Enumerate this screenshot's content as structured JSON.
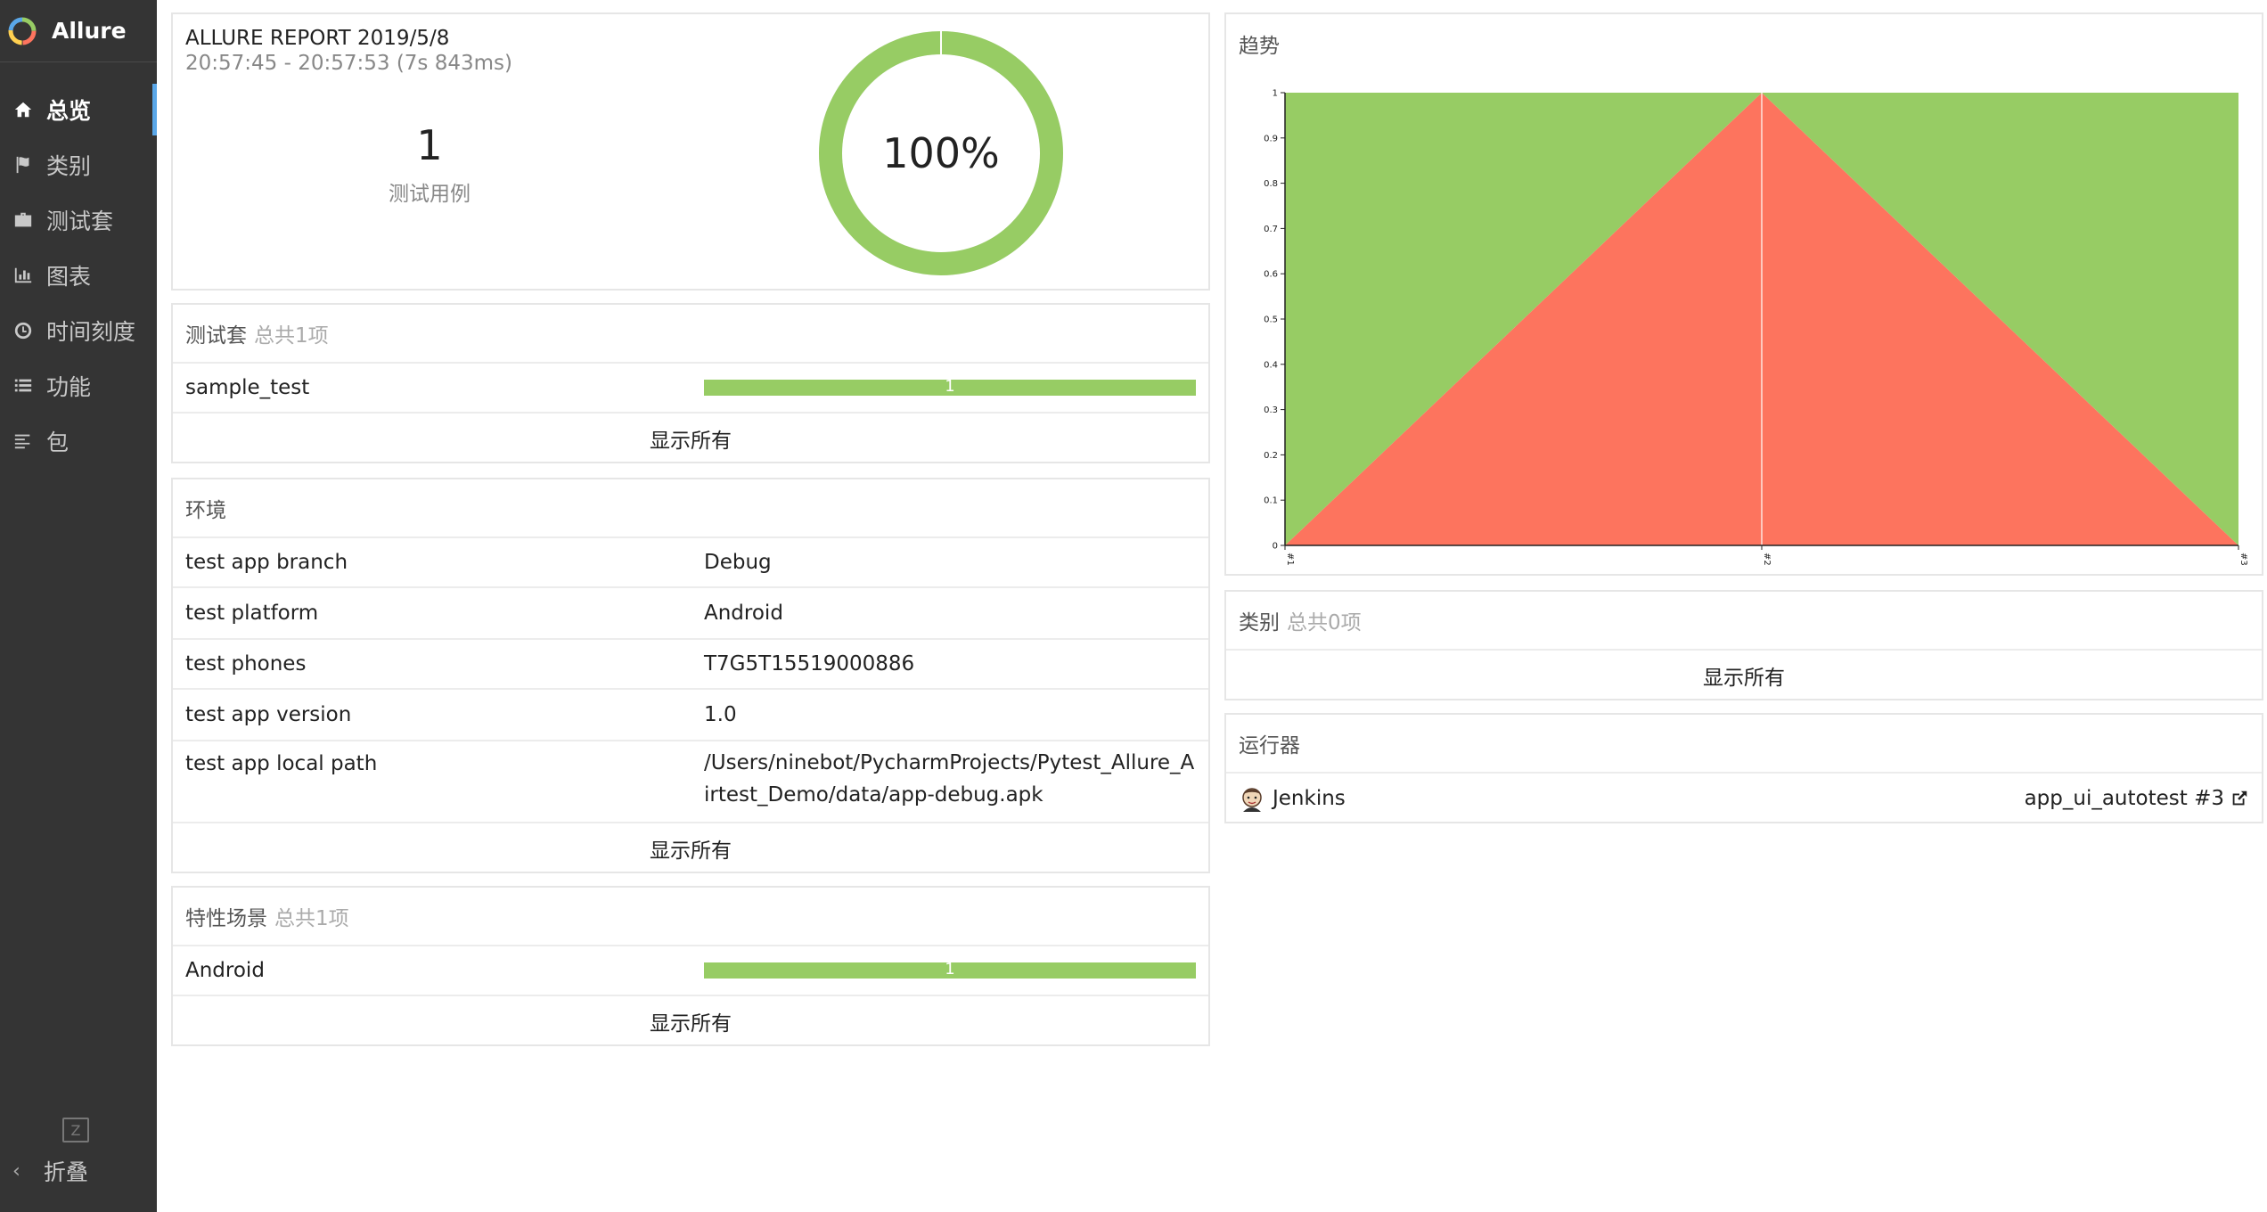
{
  "sidebar": {
    "brand": "Allure",
    "items": [
      {
        "label": "总览",
        "icon": "home-icon",
        "active": true
      },
      {
        "label": "类别",
        "icon": "flag-icon"
      },
      {
        "label": "测试套",
        "icon": "briefcase-icon"
      },
      {
        "label": "图表",
        "icon": "bar-chart-icon"
      },
      {
        "label": "时间刻度",
        "icon": "clock-icon"
      },
      {
        "label": "功能",
        "icon": "list-icon"
      },
      {
        "label": "包",
        "icon": "align-left-icon"
      }
    ],
    "zh_toggle": "Z",
    "collapse_label": "折叠"
  },
  "summary": {
    "title": "ALLURE REPORT 2019/5/8",
    "time": "20:57:45 - 20:57:53 (7s 843ms)",
    "count": "1",
    "count_label": "测试用例",
    "percent": "100%",
    "pass_fraction": 1.0,
    "pass_color": "#97cc64"
  },
  "suites": {
    "title": "测试套",
    "total": "总共1项",
    "rows": [
      {
        "name": "sample_test",
        "bar_value": "1"
      }
    ],
    "show_all": "显示所有"
  },
  "environment": {
    "title": "环境",
    "rows": [
      {
        "key": "test app branch",
        "value": "Debug"
      },
      {
        "key": "test platform",
        "value": "Android"
      },
      {
        "key": "test phones",
        "value": "T7G5T15519000886"
      },
      {
        "key": "test app version",
        "value": "1.0"
      },
      {
        "key": "test app local path",
        "value": "/Users/ninebot/PycharmProjects/Pytest_Allure_Airtest_Demo/data/app-debug.apk"
      }
    ],
    "show_all": "显示所有"
  },
  "features": {
    "title": "特性场景",
    "total": "总共1项",
    "rows": [
      {
        "name": "Android",
        "bar_value": "1"
      }
    ],
    "show_all": "显示所有"
  },
  "trend": {
    "title": "趋势"
  },
  "chart_data": {
    "type": "area",
    "x": [
      "#1",
      "#2",
      "#3"
    ],
    "series": [
      {
        "values": [
          0,
          1,
          0
        ],
        "color": "#fd745e"
      },
      {
        "values": [
          1,
          0,
          1
        ],
        "color": "#97cc64"
      }
    ],
    "ylim": [
      0,
      1
    ],
    "yticks": [
      "0",
      "0.1",
      "0.2",
      "0.3",
      "0.4",
      "0.5",
      "0.6",
      "0.7",
      "0.8",
      "0.9",
      "1"
    ]
  },
  "categories": {
    "title": "类别",
    "total": "总共0项",
    "show_all": "显示所有"
  },
  "executors": {
    "title": "运行器",
    "name": "Jenkins",
    "build": "app_ui_autotest #3"
  }
}
